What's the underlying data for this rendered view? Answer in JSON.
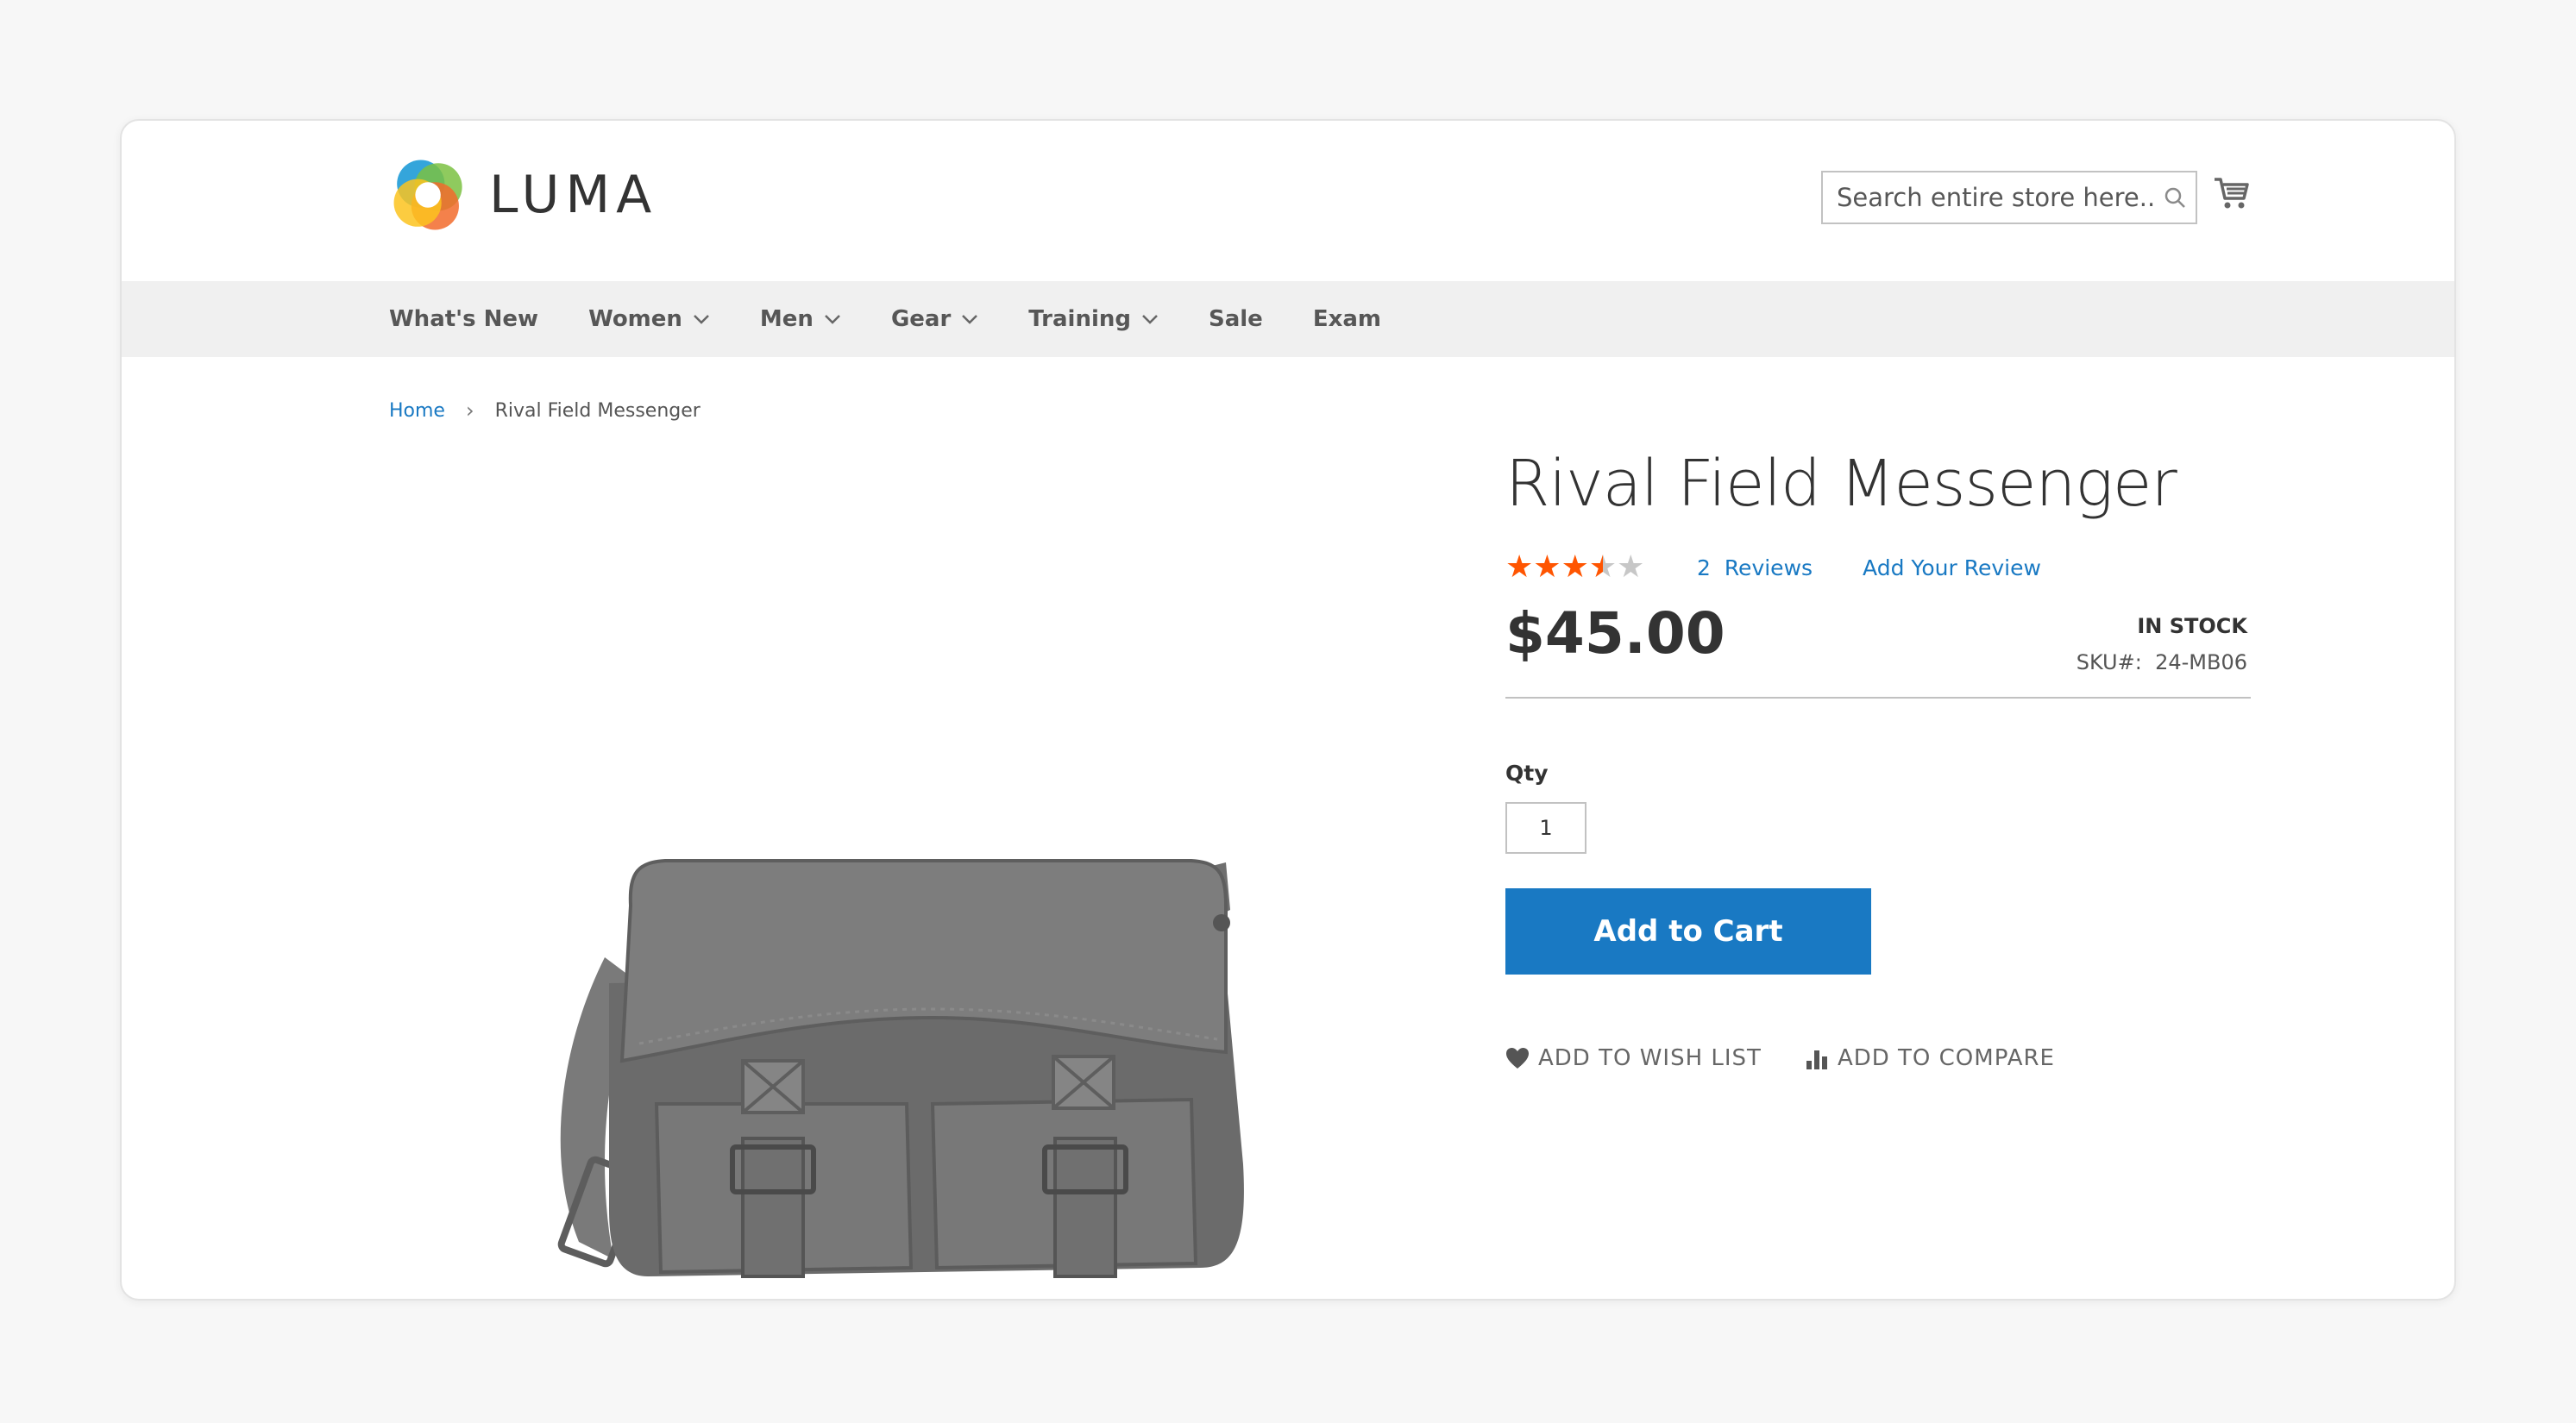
{
  "brand": {
    "name": "LUMA",
    "colors": {
      "accent": "#1979c3",
      "star": "#ff5501",
      "star_empty": "#c7c7c7"
    }
  },
  "search": {
    "placeholder": "Search entire store here..."
  },
  "nav": {
    "items": [
      {
        "label": "What's New",
        "has_dropdown": false
      },
      {
        "label": "Women",
        "has_dropdown": true
      },
      {
        "label": "Men",
        "has_dropdown": true
      },
      {
        "label": "Gear",
        "has_dropdown": true
      },
      {
        "label": "Training",
        "has_dropdown": true
      },
      {
        "label": "Sale",
        "has_dropdown": false
      },
      {
        "label": "Exam",
        "has_dropdown": false
      }
    ]
  },
  "breadcrumb": {
    "home": "Home",
    "separator": "›",
    "current": "Rival Field Messenger"
  },
  "product": {
    "name": "Rival Field Messenger",
    "rating": {
      "value": 3.5,
      "max": 5,
      "reviews_count": "2",
      "reviews_label": "Reviews",
      "add_review_label": "Add Your Review"
    },
    "price": "$45.00",
    "stock_status": "IN STOCK",
    "sku_label": "SKU#:",
    "sku": "24-MB06",
    "qty_label": "Qty",
    "qty_value": "1",
    "add_to_cart_label": "Add to Cart",
    "wishlist_label": "ADD TO WISH LIST",
    "compare_label": "ADD TO COMPARE",
    "image_icon": "messenger-bag-image"
  }
}
